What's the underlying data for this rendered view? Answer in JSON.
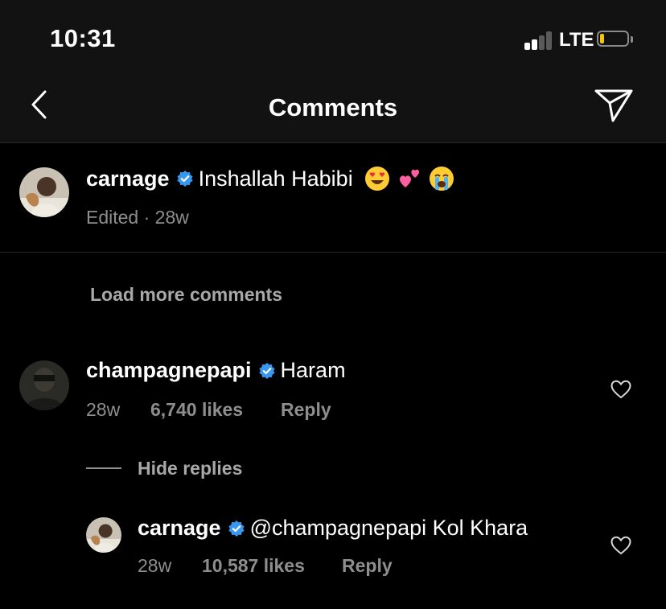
{
  "status_bar": {
    "time": "10:31",
    "network": "LTE",
    "battery_level": 0.15,
    "signal_bars_filled": 2,
    "signal_bars_total": 4
  },
  "nav": {
    "title": "Comments",
    "back_icon": "chevron-left-icon",
    "share_icon": "paper-plane-icon"
  },
  "caption": {
    "username": "carnage",
    "text": "Inshallah Habibi",
    "emojis": [
      "heart-eyes-emoji",
      "two-hearts-emoji",
      "crying-face-emoji"
    ],
    "meta": "Edited · 28w"
  },
  "load_more": "Load more comments",
  "comments": [
    {
      "username": "champagnepapi",
      "text": "Haram",
      "time": "28w",
      "likes": "6,740 likes",
      "reply": "Reply"
    }
  ],
  "hide_replies": "Hide replies",
  "replies": [
    {
      "username": "carnage",
      "text": "@champagnepapi Kol Khara",
      "time": "28w",
      "likes": "10,587 likes",
      "reply": "Reply"
    }
  ],
  "colors": {
    "background": "#000000",
    "bar": "#121212",
    "muted": "#8e8e8e",
    "verified": "#3897f0",
    "battery": "#f6c700"
  }
}
